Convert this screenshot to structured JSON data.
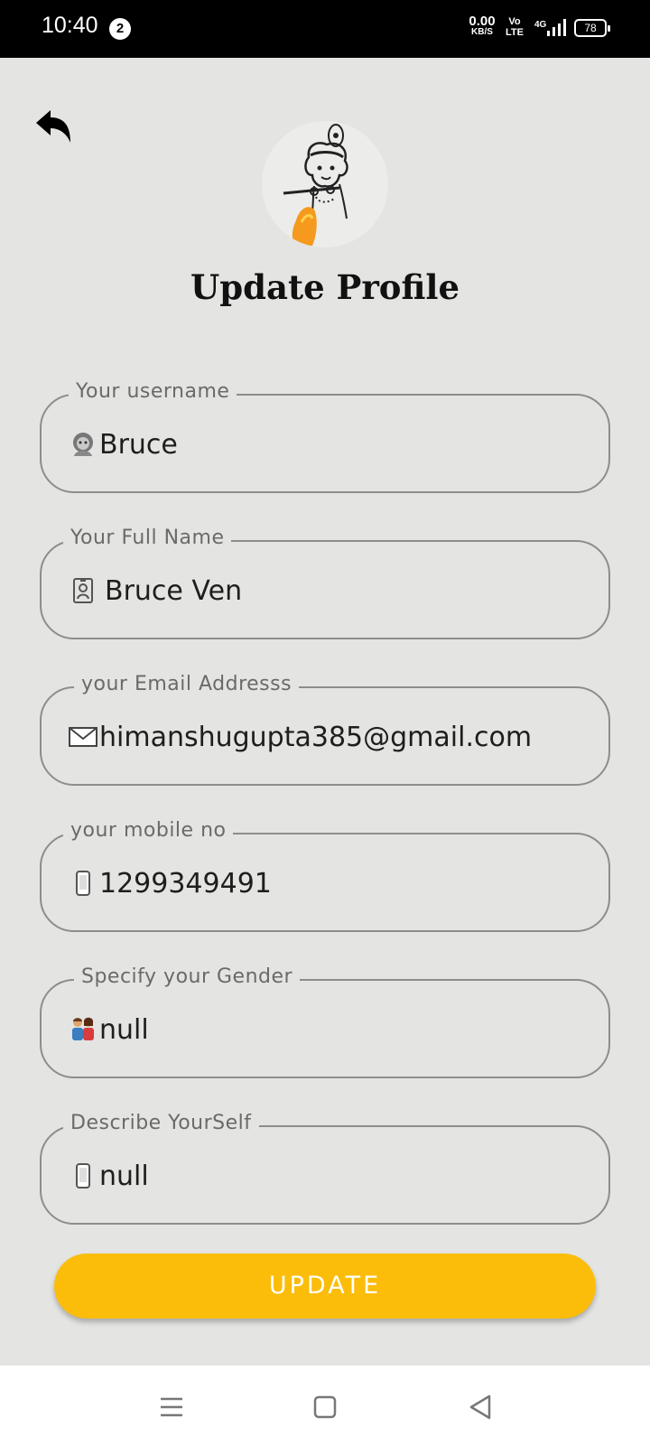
{
  "status_bar": {
    "time": "10:40",
    "notification_count": "2",
    "net_speed_value": "0.00",
    "net_speed_unit": "KB/S",
    "volte_top": "Vo",
    "volte_bottom": "LTE",
    "network_type": "4G",
    "battery": "78"
  },
  "header": {
    "title": "Update Profile",
    "back_icon": "reply-arrow-icon",
    "avatar": "profile-avatar-illustration"
  },
  "fields": [
    {
      "name": "username",
      "label": "Your username",
      "value": "Bruce",
      "icon": "avatar-emoji-icon"
    },
    {
      "name": "full-name",
      "label": "Your Full Name",
      "value": "Bruce Ven",
      "icon": "id-card-icon"
    },
    {
      "name": "email",
      "label": "your Email Addresss",
      "value": "himanshugupta385@gmail.com",
      "icon": "envelope-icon"
    },
    {
      "name": "mobile",
      "label": "your mobile no",
      "value": "1299349491",
      "icon": "mobile-phone-icon"
    },
    {
      "name": "gender",
      "label": "Specify your Gender",
      "value": "null",
      "icon": "couple-icon"
    },
    {
      "name": "bio",
      "label": "Describe YourSelf",
      "value": "null",
      "icon": "mobile-phone-icon"
    }
  ],
  "actions": {
    "update_label": "UPDATE",
    "accent_color": "#fbbd0a"
  },
  "nav_bar": {
    "icons": [
      "menu-icon",
      "home-square-icon",
      "back-triangle-icon"
    ]
  }
}
